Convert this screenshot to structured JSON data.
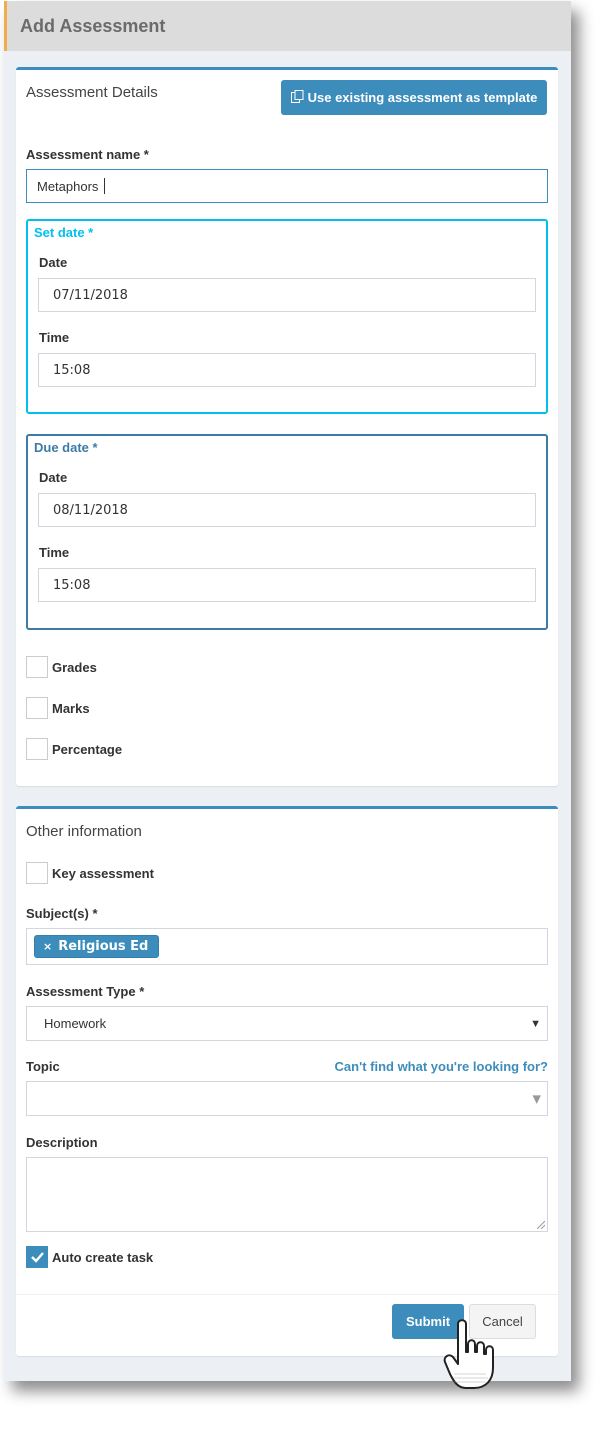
{
  "header": {
    "title": "Add Assessment"
  },
  "details": {
    "title": "Assessment Details",
    "template_button": "Use existing assessment as template",
    "name_label": "Assessment name *",
    "name_value": "Metaphors",
    "set_date": {
      "legend": "Set date *",
      "date_label": "Date",
      "date_value": "07/11/2018",
      "time_label": "Time",
      "time_value": "15:08"
    },
    "due_date": {
      "legend": "Due date *",
      "date_label": "Date",
      "date_value": "08/11/2018",
      "time_label": "Time",
      "time_value": "15:08"
    },
    "options": [
      "Grades",
      "Marks",
      "Percentage"
    ]
  },
  "other": {
    "title": "Other information",
    "key_assessment": "Key assessment",
    "subjects_label": "Subject(s) *",
    "subject_tags": [
      {
        "remove": "×",
        "label": "Religious Ed"
      }
    ],
    "type_label": "Assessment Type *",
    "type_value": "Homework",
    "topic_label": "Topic",
    "topic_help": "Can't find what you're looking for?",
    "topic_value": "",
    "description_label": "Description",
    "auto_create_task": "Auto create task",
    "auto_create_checked": true
  },
  "footer": {
    "submit": "Submit",
    "cancel": "Cancel"
  },
  "colors": {
    "primary": "#3c8dbc",
    "set_date_border": "#00c0ef",
    "due_date_border": "#3c7ba8",
    "header_accent": "#f0ad4e"
  },
  "icons": [
    "copy-icon",
    "times-icon",
    "caret-down-icon",
    "check-icon",
    "hand-pointer-icon"
  ]
}
